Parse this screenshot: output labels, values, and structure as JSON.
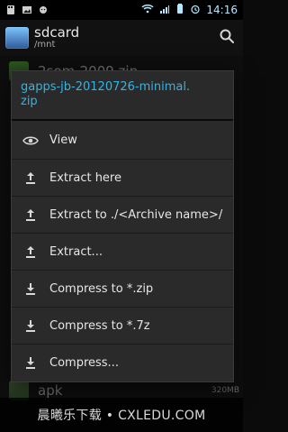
{
  "status_bar": {
    "time": "14:16"
  },
  "action_bar": {
    "title": "sdcard",
    "path": "/mnt"
  },
  "background_list": {
    "items": [
      {
        "name": "2sem-2009.zip",
        "size": ""
      },
      {
        "name": "apk",
        "size": "320MB"
      }
    ]
  },
  "dialog": {
    "title": "gapps-jb-20120726-minimal.\nzip",
    "items": [
      {
        "label": "View",
        "icon": "eye-icon"
      },
      {
        "label": "Extract here",
        "icon": "upload-icon"
      },
      {
        "label": "Extract to ./<Archive name>/",
        "icon": "upload-icon"
      },
      {
        "label": "Extract...",
        "icon": "upload-icon"
      },
      {
        "label": "Compress to *.zip",
        "icon": "download-icon"
      },
      {
        "label": "Compress to *.7z",
        "icon": "download-icon"
      },
      {
        "label": "Compress...",
        "icon": "download-icon"
      }
    ]
  },
  "watermark": {
    "text": "晨曦乐下载 • CXLEDU.COM"
  },
  "colors": {
    "accent": "#32b5e5",
    "dialog_bg": "#2a2a2a",
    "status_icon": "#b7e7ff"
  }
}
